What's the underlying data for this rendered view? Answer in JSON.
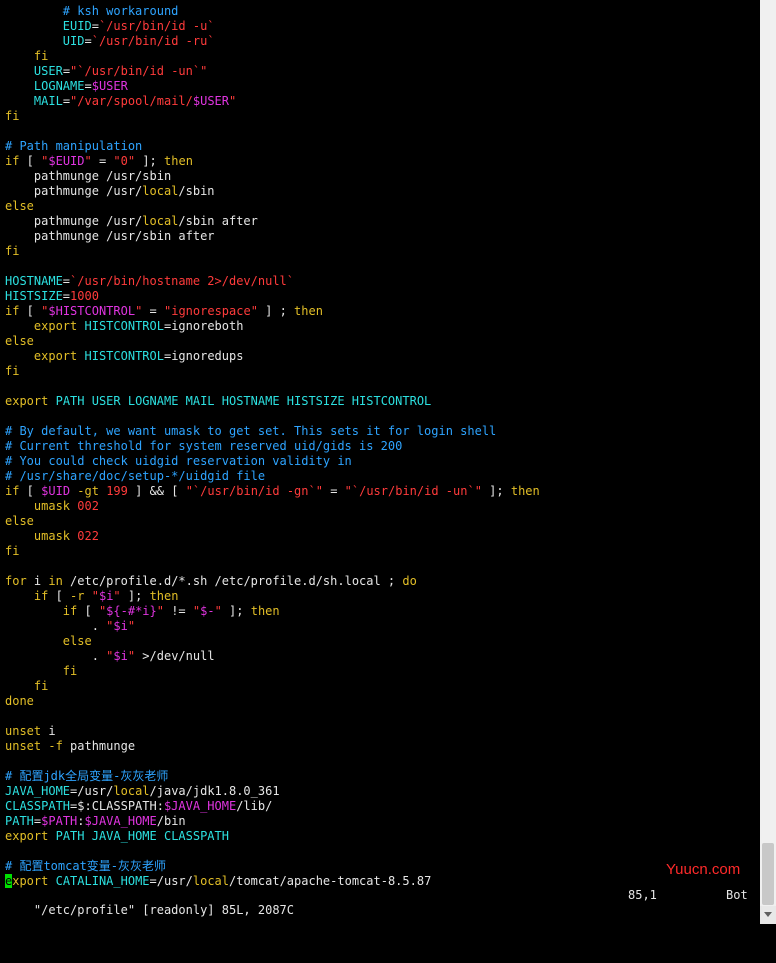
{
  "editor": {
    "lines": [
      [
        {
          "t": "        "
        },
        {
          "t": "# ksh workaround",
          "c": "cm"
        }
      ],
      [
        {
          "t": "        "
        },
        {
          "t": "EUID",
          "c": "id"
        },
        {
          "t": "="
        },
        {
          "t": "`/usr/bin/id -u`",
          "c": "st"
        }
      ],
      [
        {
          "t": "        "
        },
        {
          "t": "UID",
          "c": "id"
        },
        {
          "t": "="
        },
        {
          "t": "`/usr/bin/id -ru`",
          "c": "st"
        }
      ],
      [
        {
          "t": "    "
        },
        {
          "t": "fi",
          "c": "kw"
        }
      ],
      [
        {
          "t": "    "
        },
        {
          "t": "USER",
          "c": "id"
        },
        {
          "t": "="
        },
        {
          "t": "\"`/usr/bin/id -un`\"",
          "c": "st"
        }
      ],
      [
        {
          "t": "    "
        },
        {
          "t": "LOGNAME",
          "c": "id"
        },
        {
          "t": "="
        },
        {
          "t": "$USER",
          "c": "vr"
        }
      ],
      [
        {
          "t": "    "
        },
        {
          "t": "MAIL",
          "c": "id"
        },
        {
          "t": "="
        },
        {
          "t": "\"/var/spool/mail/",
          "c": "st"
        },
        {
          "t": "$USER",
          "c": "vr"
        },
        {
          "t": "\"",
          "c": "st"
        }
      ],
      [
        {
          "t": "fi",
          "c": "kw"
        }
      ],
      [],
      [
        {
          "t": "# Path manipulation",
          "c": "cm"
        }
      ],
      [
        {
          "t": "if",
          "c": "kw"
        },
        {
          "t": " [ "
        },
        {
          "t": "\"",
          "c": "st"
        },
        {
          "t": "$EUID",
          "c": "vr"
        },
        {
          "t": "\"",
          "c": "st"
        },
        {
          "t": " = "
        },
        {
          "t": "\"0\"",
          "c": "st"
        },
        {
          "t": " ]; "
        },
        {
          "t": "then",
          "c": "kw"
        }
      ],
      [
        {
          "t": "    pathmunge /usr/sbin"
        }
      ],
      [
        {
          "t": "    pathmunge /usr/"
        },
        {
          "t": "local",
          "c": "kw"
        },
        {
          "t": "/sbin"
        }
      ],
      [
        {
          "t": "else",
          "c": "kw"
        }
      ],
      [
        {
          "t": "    pathmunge /usr/"
        },
        {
          "t": "local",
          "c": "kw"
        },
        {
          "t": "/sbin after"
        }
      ],
      [
        {
          "t": "    pathmunge /usr/sbin after"
        }
      ],
      [
        {
          "t": "fi",
          "c": "kw"
        }
      ],
      [],
      [
        {
          "t": "HOSTNAME",
          "c": "id"
        },
        {
          "t": "="
        },
        {
          "t": "`/usr/bin/hostname 2>/dev/null`",
          "c": "st"
        }
      ],
      [
        {
          "t": "HISTSIZE",
          "c": "id"
        },
        {
          "t": "="
        },
        {
          "t": "1000",
          "c": "st"
        }
      ],
      [
        {
          "t": "if",
          "c": "kw"
        },
        {
          "t": " [ "
        },
        {
          "t": "\"",
          "c": "st"
        },
        {
          "t": "$HISTCONTROL",
          "c": "vr"
        },
        {
          "t": "\"",
          "c": "st"
        },
        {
          "t": " = "
        },
        {
          "t": "\"ignorespace\"",
          "c": "st"
        },
        {
          "t": " ] ; "
        },
        {
          "t": "then",
          "c": "kw"
        }
      ],
      [
        {
          "t": "    "
        },
        {
          "t": "export",
          "c": "kw"
        },
        {
          "t": " "
        },
        {
          "t": "HISTCONTROL",
          "c": "id"
        },
        {
          "t": "=ignoreboth"
        }
      ],
      [
        {
          "t": "else",
          "c": "kw"
        }
      ],
      [
        {
          "t": "    "
        },
        {
          "t": "export",
          "c": "kw"
        },
        {
          "t": " "
        },
        {
          "t": "HISTCONTROL",
          "c": "id"
        },
        {
          "t": "=ignoredups"
        }
      ],
      [
        {
          "t": "fi",
          "c": "kw"
        }
      ],
      [],
      [
        {
          "t": "export",
          "c": "kw"
        },
        {
          "t": " "
        },
        {
          "t": "PATH USER LOGNAME MAIL HOSTNAME HISTSIZE HISTCONTROL",
          "c": "id"
        }
      ],
      [],
      [
        {
          "t": "# By default, we want umask to get set. This sets it for login shell",
          "c": "cm"
        }
      ],
      [
        {
          "t": "# Current threshold for system reserved uid/gids is 200",
          "c": "cm"
        }
      ],
      [
        {
          "t": "# You could check uidgid reservation validity in",
          "c": "cm"
        }
      ],
      [
        {
          "t": "# /usr/share/doc/setup-*/uidgid file",
          "c": "cm"
        }
      ],
      [
        {
          "t": "if",
          "c": "kw"
        },
        {
          "t": " [ "
        },
        {
          "t": "$UID",
          "c": "vr"
        },
        {
          "t": " "
        },
        {
          "t": "-gt",
          "c": "kw"
        },
        {
          "t": " "
        },
        {
          "t": "199",
          "c": "st"
        },
        {
          "t": " ] && [ "
        },
        {
          "t": "\"`/usr/bin/id -gn`\"",
          "c": "st"
        },
        {
          "t": " = "
        },
        {
          "t": "\"`/usr/bin/id -un`\"",
          "c": "st"
        },
        {
          "t": " ]; "
        },
        {
          "t": "then",
          "c": "kw"
        }
      ],
      [
        {
          "t": "    "
        },
        {
          "t": "umask",
          "c": "kw"
        },
        {
          "t": " "
        },
        {
          "t": "002",
          "c": "st"
        }
      ],
      [
        {
          "t": "else",
          "c": "kw"
        }
      ],
      [
        {
          "t": "    "
        },
        {
          "t": "umask",
          "c": "kw"
        },
        {
          "t": " "
        },
        {
          "t": "022",
          "c": "st"
        }
      ],
      [
        {
          "t": "fi",
          "c": "kw"
        }
      ],
      [],
      [
        {
          "t": "for",
          "c": "kw"
        },
        {
          "t": " i "
        },
        {
          "t": "in",
          "c": "kw"
        },
        {
          "t": " /etc/profile.d/*.sh /etc/profile.d/sh.local ; "
        },
        {
          "t": "do",
          "c": "kw"
        }
      ],
      [
        {
          "t": "    "
        },
        {
          "t": "if",
          "c": "kw"
        },
        {
          "t": " [ "
        },
        {
          "t": "-r",
          "c": "kw"
        },
        {
          "t": " "
        },
        {
          "t": "\"",
          "c": "st"
        },
        {
          "t": "$i",
          "c": "vr"
        },
        {
          "t": "\"",
          "c": "st"
        },
        {
          "t": " ]; "
        },
        {
          "t": "then",
          "c": "kw"
        }
      ],
      [
        {
          "t": "        "
        },
        {
          "t": "if",
          "c": "kw"
        },
        {
          "t": " [ "
        },
        {
          "t": "\"",
          "c": "st"
        },
        {
          "t": "${-#*i}",
          "c": "vr"
        },
        {
          "t": "\"",
          "c": "st"
        },
        {
          "t": " != "
        },
        {
          "t": "\"",
          "c": "st"
        },
        {
          "t": "$-",
          "c": "vr"
        },
        {
          "t": "\"",
          "c": "st"
        },
        {
          "t": " ]; "
        },
        {
          "t": "then",
          "c": "kw"
        }
      ],
      [
        {
          "t": "            . "
        },
        {
          "t": "\"",
          "c": "st"
        },
        {
          "t": "$i",
          "c": "vr"
        },
        {
          "t": "\"",
          "c": "st"
        }
      ],
      [
        {
          "t": "        "
        },
        {
          "t": "else",
          "c": "kw"
        }
      ],
      [
        {
          "t": "            . "
        },
        {
          "t": "\"",
          "c": "st"
        },
        {
          "t": "$i",
          "c": "vr"
        },
        {
          "t": "\"",
          "c": "st"
        },
        {
          "t": " >/dev/null"
        }
      ],
      [
        {
          "t": "        "
        },
        {
          "t": "fi",
          "c": "kw"
        }
      ],
      [
        {
          "t": "    "
        },
        {
          "t": "fi",
          "c": "kw"
        }
      ],
      [
        {
          "t": "done",
          "c": "kw"
        }
      ],
      [],
      [
        {
          "t": "unset",
          "c": "kw"
        },
        {
          "t": " i"
        }
      ],
      [
        {
          "t": "unset",
          "c": "kw"
        },
        {
          "t": " "
        },
        {
          "t": "-f",
          "c": "kw"
        },
        {
          "t": " pathmunge"
        }
      ],
      [],
      [
        {
          "t": "# 配置jdk全局变量-灰灰老师",
          "c": "cm"
        }
      ],
      [
        {
          "t": "JAVA_HOME",
          "c": "id"
        },
        {
          "t": "=/usr/"
        },
        {
          "t": "local",
          "c": "kw"
        },
        {
          "t": "/java/jdk1.8.0_361"
        }
      ],
      [
        {
          "t": "CLASSPATH",
          "c": "id"
        },
        {
          "t": "=$:CLASSPATH:"
        },
        {
          "t": "$JAVA_HOME",
          "c": "vr"
        },
        {
          "t": "/lib/"
        }
      ],
      [
        {
          "t": "PATH",
          "c": "id"
        },
        {
          "t": "="
        },
        {
          "t": "$PATH",
          "c": "vr"
        },
        {
          "t": ":"
        },
        {
          "t": "$JAVA_HOME",
          "c": "vr"
        },
        {
          "t": "/bin"
        }
      ],
      [
        {
          "t": "export",
          "c": "kw"
        },
        {
          "t": " "
        },
        {
          "t": "PATH JAVA_HOME CLASSPATH",
          "c": "id"
        }
      ],
      [],
      [
        {
          "t": "# 配置tomcat变量-灰灰老师",
          "c": "cm"
        }
      ],
      [
        {
          "t": "e",
          "c": "cursor"
        },
        {
          "t": "xport",
          "c": "kw"
        },
        {
          "t": " "
        },
        {
          "t": "CATALINA_HOME",
          "c": "id"
        },
        {
          "t": "=/usr/"
        },
        {
          "t": "local",
          "c": "kw"
        },
        {
          "t": "/tomcat/apache-tomcat-8.5.87"
        }
      ]
    ]
  },
  "statusline": {
    "file_info": "\"/etc/profile\" [readonly] 85L, 2087C",
    "position": "85,1",
    "percent": "Bot"
  },
  "watermark": "Yuucn.com",
  "colors": {
    "background": "#000000",
    "comment": "#2ea4ff",
    "keyword": "#e3bf27",
    "string": "#ff3b3b",
    "variable": "#e034e0",
    "identifier": "#2ce0e0",
    "cursor": "#00e000"
  }
}
